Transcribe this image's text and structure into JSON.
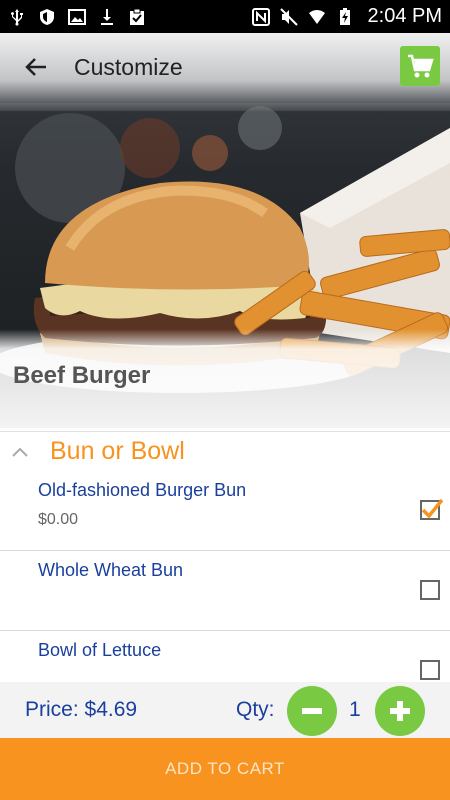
{
  "status_bar": {
    "time": "2:04 PM",
    "icons_left": [
      "usb-icon",
      "shield-icon",
      "image-icon",
      "download-icon",
      "clipboard-check-icon"
    ],
    "icons_right": [
      "nfc-icon",
      "mute-icon",
      "wifi-icon",
      "battery-charging-icon"
    ]
  },
  "app_bar": {
    "title": "Customize",
    "back_icon": "arrow-left-icon",
    "cart_icon": "shopping-cart-icon"
  },
  "product": {
    "name": "Beef Burger",
    "image": "burger-and-fries-photo"
  },
  "section": {
    "title": "Bun or Bowl",
    "collapse_icon": "chevron-up-icon",
    "options": [
      {
        "name": "Old-fashioned Burger Bun",
        "price": "$0.00",
        "checked": true
      },
      {
        "name": "Whole Wheat Bun",
        "price": "",
        "checked": false
      },
      {
        "name": "Bowl of Lettuce",
        "price": "",
        "checked": false
      }
    ]
  },
  "price_bar": {
    "price_label": "Price: $4.69",
    "qty_label": "Qty:",
    "qty_value": "1"
  },
  "add_to_cart_label": "ADD TO CART",
  "colors": {
    "accent_orange": "#f7931e",
    "accent_green": "#7ac943",
    "text_blue": "#1a3f9c"
  }
}
